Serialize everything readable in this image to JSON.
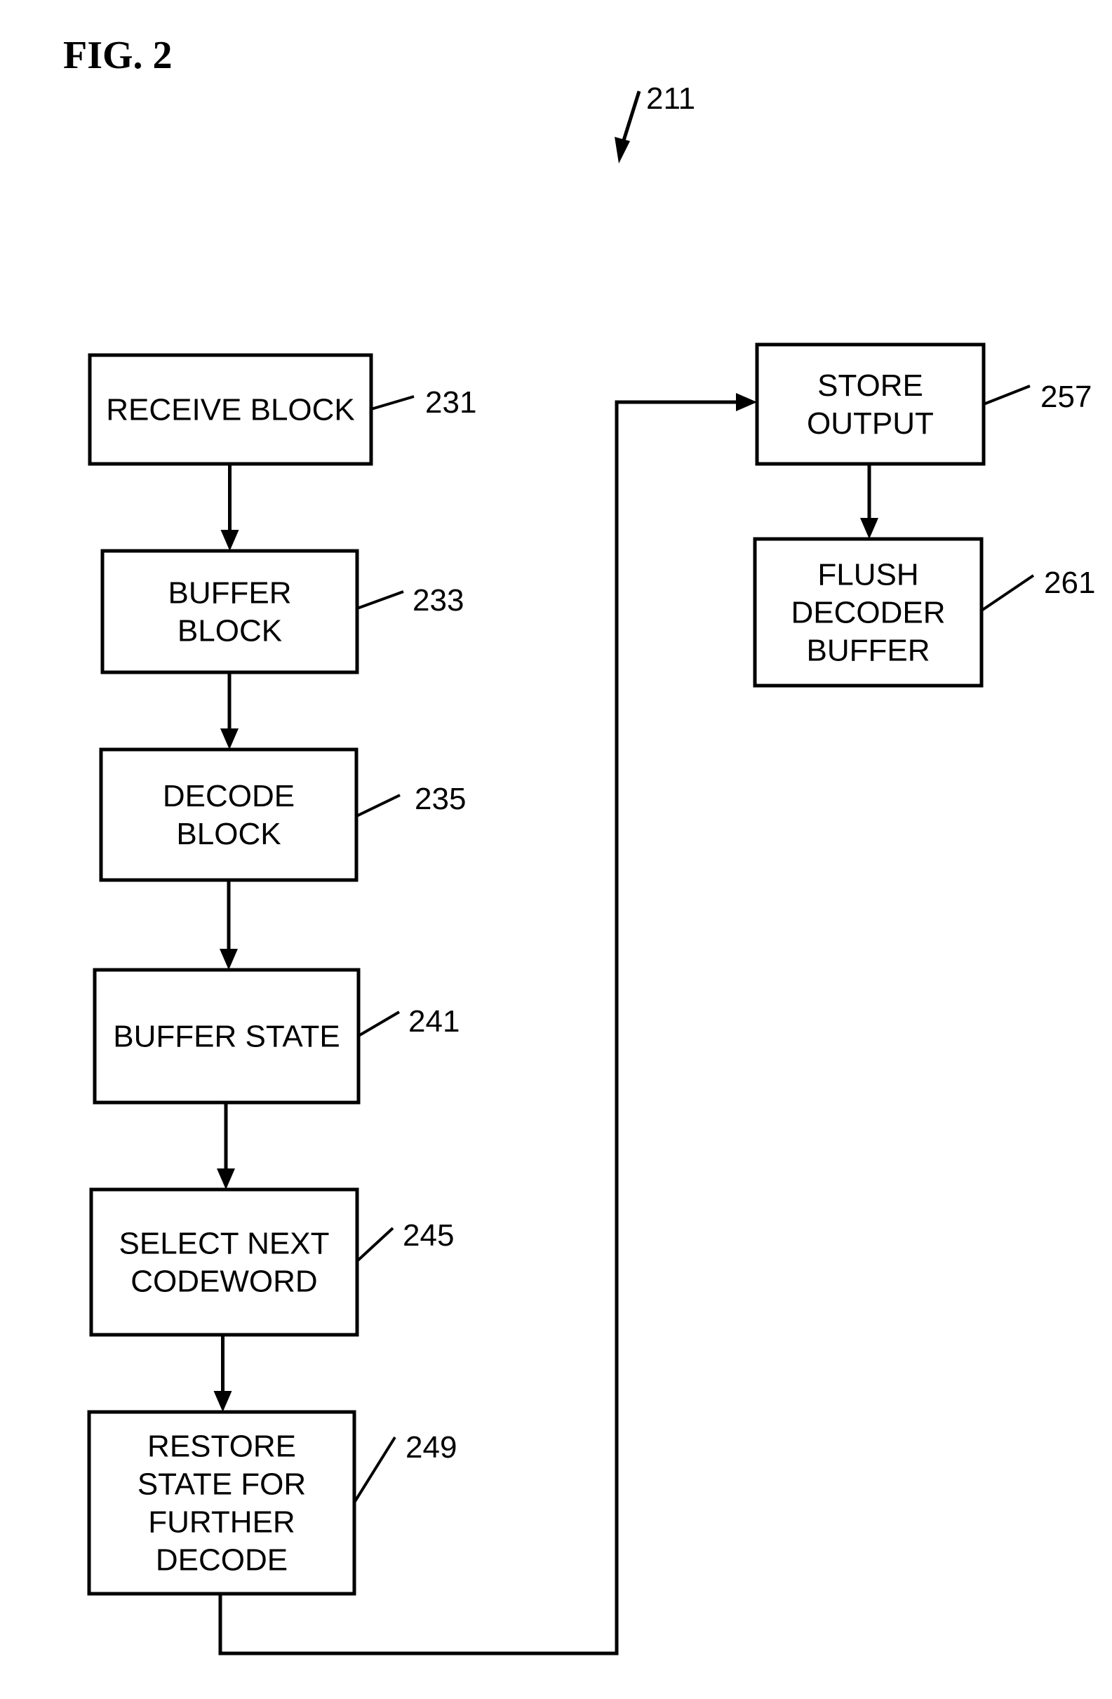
{
  "figure": {
    "title": "FIG. 2",
    "reference": "211"
  },
  "steps": [
    {
      "id": "231",
      "lines": [
        "RECEIVE BLOCK"
      ]
    },
    {
      "id": "233",
      "lines": [
        "BUFFER",
        "BLOCK"
      ]
    },
    {
      "id": "235",
      "lines": [
        "DECODE",
        "BLOCK"
      ]
    },
    {
      "id": "241",
      "lines": [
        "BUFFER STATE"
      ]
    },
    {
      "id": "245",
      "lines": [
        "SELECT NEXT",
        "CODEWORD"
      ]
    },
    {
      "id": "249",
      "lines": [
        "RESTORE",
        "STATE FOR",
        "FURTHER",
        "DECODE"
      ]
    },
    {
      "id": "257",
      "lines": [
        "STORE",
        "OUTPUT"
      ]
    },
    {
      "id": "261",
      "lines": [
        "FLUSH",
        "DECODER",
        "BUFFER"
      ]
    }
  ],
  "flow": [
    [
      "231",
      "233"
    ],
    [
      "233",
      "235"
    ],
    [
      "235",
      "241"
    ],
    [
      "241",
      "245"
    ],
    [
      "245",
      "249"
    ],
    [
      "249",
      "257"
    ],
    [
      "257",
      "261"
    ]
  ]
}
